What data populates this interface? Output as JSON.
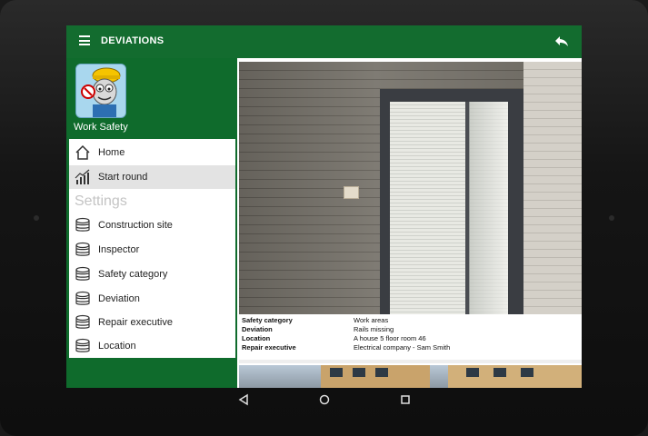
{
  "appbar": {
    "title": "DEVIATIONS",
    "menu_icon": "hamburger-icon",
    "back_icon": "reply-arrow-icon"
  },
  "drawer": {
    "app_name": "Work Safety",
    "app_icon": "work-safety-app-icon",
    "items": [
      {
        "label": "Home",
        "icon": "home-icon"
      },
      {
        "label": "Start round",
        "icon": "chart-icon",
        "active": true
      }
    ],
    "settings_header": "Settings",
    "settings_items": [
      {
        "label": "Construction site",
        "icon": "database-icon"
      },
      {
        "label": "Inspector",
        "icon": "database-icon"
      },
      {
        "label": "Safety category",
        "icon": "database-icon"
      },
      {
        "label": "Deviation",
        "icon": "database-icon"
      },
      {
        "label": "Repair executive",
        "icon": "database-icon"
      },
      {
        "label": "Location",
        "icon": "database-icon"
      }
    ]
  },
  "deviation": {
    "fields": [
      {
        "key": "Safety category",
        "value": "Work areas"
      },
      {
        "key": "Deviation",
        "value": "Rails missing"
      },
      {
        "key": "Location",
        "value": "A house 5 floor room 46"
      },
      {
        "key": "Repair executive",
        "value": "Electrical company - Sam Smith"
      }
    ]
  },
  "navbar": {
    "back": "back-triangle-icon",
    "home": "home-circle-icon",
    "recents": "recents-square-icon"
  },
  "colors": {
    "primary": "#136c2f",
    "drawer": "#0f6b2c",
    "active_item": "#e3e3e3",
    "settings_header": "#c4c4c4"
  }
}
